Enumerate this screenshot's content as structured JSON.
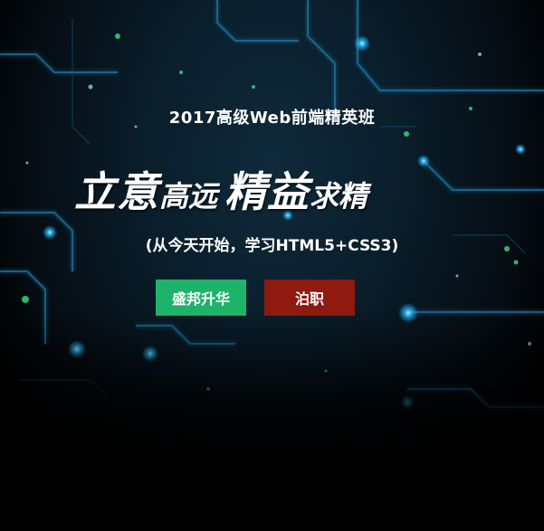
{
  "banner": {
    "subtitle": "2017高级Web前端精英班",
    "headline": {
      "part1": "立意",
      "part2": "高远",
      "part3": "精益",
      "part4": "求精"
    },
    "tagline": "(从今天开始，学习HTML5+CSS3)"
  },
  "buttons": {
    "primary_label": "盛邦升华",
    "secondary_label": "泊职"
  },
  "colors": {
    "primary_button": "#1db36b",
    "secondary_button": "#8e1a10",
    "circuit_glow": "#1fb8ff",
    "dot_green": "#3ddc84"
  }
}
